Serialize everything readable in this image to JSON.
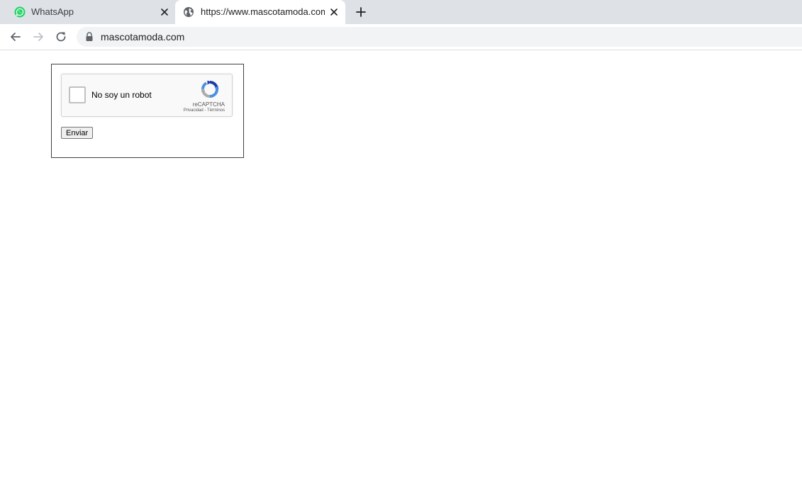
{
  "browser": {
    "tabs": [
      {
        "title": "WhatsApp",
        "icon": "whatsapp-icon",
        "active": false
      },
      {
        "title": "https://www.mascotamoda.com",
        "icon": "globe-icon",
        "active": true
      }
    ],
    "address_bar": {
      "url": "mascotamoda.com",
      "secure_icon": "lock-icon"
    },
    "nav_buttons": [
      "back-arrow-icon",
      "forward-arrow-icon",
      "reload-icon"
    ]
  },
  "page": {
    "recaptcha": {
      "label": "No soy un robot",
      "brand": "reCAPTCHA",
      "privacy_link": "Privacidad",
      "separator": " - ",
      "terms_link": "Términos"
    },
    "submit_label": "Enviar"
  },
  "colors": {
    "tabstrip_bg": "#dee1e6",
    "whatsapp_green": "#25d366",
    "recaptcha_blue": "#1c3aa9",
    "recaptcha_light_blue": "#4a90e2"
  }
}
